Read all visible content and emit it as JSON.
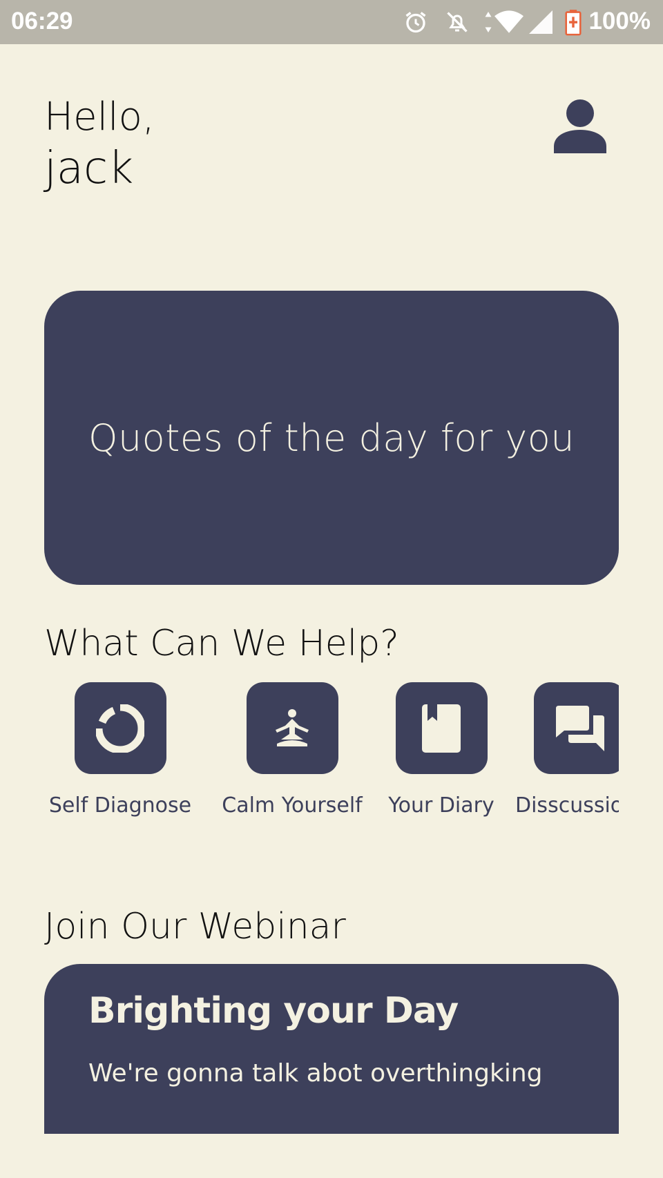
{
  "status_bar": {
    "time": "06:29",
    "battery": "100%",
    "icons": [
      "alarm-icon",
      "notifications-off-icon",
      "data-arrows-icon",
      "wifi-icon",
      "cell-signal-icon",
      "battery-charging-icon"
    ]
  },
  "greeting": {
    "hello": "Hello,",
    "name": "jack",
    "profile_icon": "person-icon"
  },
  "quote_card": {
    "text": "Quotes of the day for you"
  },
  "help": {
    "title": "What Can We Help?",
    "items": [
      {
        "label": "Self Diagnose",
        "icon": "donut-chart-icon"
      },
      {
        "label": "Calm Yourself",
        "icon": "meditation-icon"
      },
      {
        "label": "Your Diary",
        "icon": "book-icon"
      },
      {
        "label": "Disscussion",
        "icon": "forum-icon"
      }
    ]
  },
  "webinar": {
    "title": "Join Our Webinar",
    "card_title": "Brighting your Day",
    "card_subtitle": "We're gonna talk abot overthingking"
  },
  "colors": {
    "background": "#f4f1e1",
    "card": "#3d405b",
    "card_text": "#f4f1e1",
    "status_bar": "#b8b5aa",
    "battery_accent": "#e8643c"
  }
}
